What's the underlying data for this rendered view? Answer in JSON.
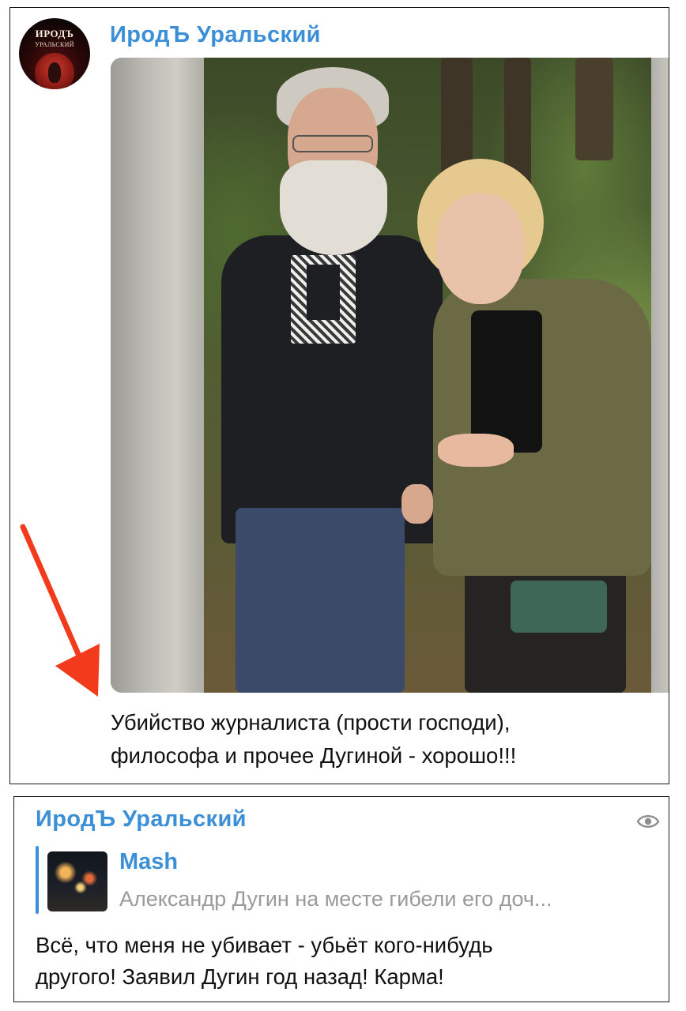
{
  "post1": {
    "channel_name": "ИродЪ Уральский",
    "avatar": {
      "line1": "ИРОДЪ",
      "line2": "УРАЛЬСКИЙ"
    },
    "caption_lines": [
      "Убийство журналиста (прости господи),",
      "философа и прочее Дугиной - хорошо!!!"
    ]
  },
  "post2": {
    "channel_name": "ИродЪ Уральский",
    "forwarded": {
      "source": "Mash",
      "preview": "Александр Дугин на месте гибели его доч..."
    },
    "text_lines": [
      "Всё, что меня не убивает - убьёт кого-нибудь",
      "другого! Заявил Дугин год назад! Карма!"
    ]
  },
  "colors": {
    "accent_blue": "#3b8fd6",
    "arrow_red": "#f23a1c",
    "muted_gray": "#9a9a9a"
  },
  "icons": {
    "views": "eye-icon",
    "annotation": "red-arrow"
  }
}
